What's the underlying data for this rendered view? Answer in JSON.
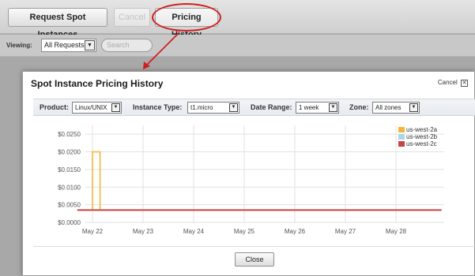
{
  "toolbar": {
    "buttons": [
      {
        "label": "Request Spot Instances",
        "state": "normal"
      },
      {
        "label": "Cancel",
        "state": "disabled"
      },
      {
        "label": "Pricing History",
        "state": "active"
      }
    ],
    "highlight_color": "#d02020"
  },
  "filterbar": {
    "viewing_label": "Viewing:",
    "viewing_value": "All Requests",
    "search_placeholder": "Search"
  },
  "dialog": {
    "title": "Spot Instance Pricing History",
    "cancel_label": "Cancel",
    "close_icon": "close-icon",
    "params": {
      "product_label": "Product:",
      "product_value": "Linux/UNIX",
      "instance_type_label": "Instance Type:",
      "instance_type_value": "t1.micro",
      "date_range_label": "Date Range:",
      "date_range_value": "1 week",
      "zone_label": "Zone:",
      "zone_value": "All zones"
    },
    "close_button": "Close"
  },
  "chart_data": {
    "type": "line",
    "x_categories": [
      "May 22",
      "May 23",
      "May 24",
      "May 25",
      "May 26",
      "May 27",
      "May 28"
    ],
    "y_ticks": [
      "$0.0000",
      "$0.0050",
      "$0.0100",
      "$0.0150",
      "$0.0200",
      "$0.0250"
    ],
    "ylim": [
      0,
      0.0275
    ],
    "grid": true,
    "legend_position": "top-right",
    "series": [
      {
        "name": "us-west-2a",
        "color": "#f2b63a",
        "points": [
          [
            -0.3,
            0.0035
          ],
          [
            0.0,
            0.0035
          ],
          [
            0.0,
            0.02
          ],
          [
            0.15,
            0.02
          ],
          [
            0.15,
            0.0035
          ],
          [
            6.9,
            0.0035
          ]
        ]
      },
      {
        "name": "us-west-2b",
        "color": "#a9d6ee",
        "points": [
          [
            -0.3,
            0.0035
          ],
          [
            6.9,
            0.0035
          ]
        ]
      },
      {
        "name": "us-west-2c",
        "color": "#c64444",
        "points": [
          [
            -0.3,
            0.0035
          ],
          [
            6.9,
            0.0035
          ]
        ]
      }
    ]
  }
}
